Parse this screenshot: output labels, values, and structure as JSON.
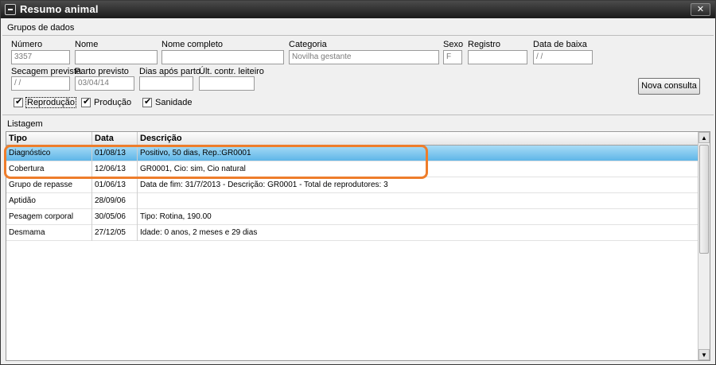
{
  "window": {
    "title": "Resumo animal",
    "close_label": "✕"
  },
  "groups": {
    "title": "Grupos de dados"
  },
  "fields": {
    "numero": {
      "label": "Número",
      "value": "3357"
    },
    "nome": {
      "label": "Nome",
      "value": ""
    },
    "nome_completo": {
      "label": "Nome completo",
      "value": ""
    },
    "categoria": {
      "label": "Categoria",
      "value": "Novilha gestante"
    },
    "sexo": {
      "label": "Sexo",
      "value": "F"
    },
    "registro": {
      "label": "Registro",
      "value": ""
    },
    "data_baixa": {
      "label": "Data de baixa",
      "value": " /  /"
    },
    "secagem": {
      "label": "Secagem prevista",
      "value": " /  /"
    },
    "parto": {
      "label": "Parto previsto",
      "value": "03/04/14"
    },
    "dias_apos_parto": {
      "label": "Dias após parto",
      "value": ""
    },
    "ult_contr": {
      "label": "Últ. contr. leiteiro",
      "value": ""
    }
  },
  "filters": {
    "reproducao": {
      "label": "Reprodução",
      "checked": true
    },
    "producao": {
      "label": "Produção",
      "checked": true
    },
    "sanidade": {
      "label": "Sanidade",
      "checked": true
    }
  },
  "actions": {
    "nova_consulta": "Nova consulta"
  },
  "listing": {
    "title": "Listagem",
    "columns": [
      "Tipo",
      "Data",
      "Descrição"
    ],
    "rows": [
      {
        "tipo": "Diagnóstico",
        "data": "01/08/13",
        "descricao": "Positivo, 50 dias, Rep.:GR0001"
      },
      {
        "tipo": "Cobertura",
        "data": "12/06/13",
        "descricao": "GR0001, Cio: sim, Cio natural"
      },
      {
        "tipo": "Grupo de repasse",
        "data": "01/06/13",
        "descricao": "Data de fim: 31/7/2013 - Descrição: GR0001 - Total de reprodutores: 3"
      },
      {
        "tipo": "Aptidão",
        "data": "28/09/06",
        "descricao": ""
      },
      {
        "tipo": "Pesagem corporal",
        "data": "30/05/06",
        "descricao": "Tipo: Rotina, 190.00"
      },
      {
        "tipo": "Desmama",
        "data": "27/12/05",
        "descricao": "Idade: 0 anos, 2 meses e 29 dias"
      }
    ],
    "selected_row": 0
  },
  "colors": {
    "highlight": "#ee7d2b",
    "selection": "#5fb6e8"
  }
}
